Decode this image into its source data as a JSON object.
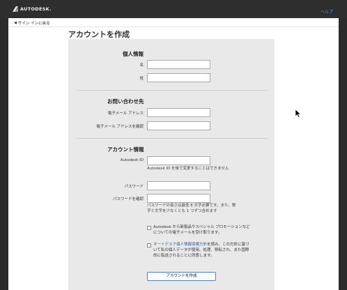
{
  "header": {
    "brand": "AUTODESK.",
    "help": "ヘルプ"
  },
  "nav": {
    "back": "サイン インに戻る"
  },
  "page": {
    "title": "アカウントを作成"
  },
  "personal": {
    "title": "個人情報",
    "first_name_label": "名",
    "last_name_label": "姓",
    "first_name_value": "",
    "last_name_value": ""
  },
  "contact": {
    "title": "お問い合わせ先",
    "email_label": "電子メール アドレス",
    "email_confirm_label": "電子メール アドレスを確認",
    "email_value": "",
    "email_confirm_value": ""
  },
  "account": {
    "title": "アカウント情報",
    "id_label": "Autodesk ID",
    "id_hint": "Autodesk ID を後で変更することはできません",
    "password_label": "パスワード",
    "password_confirm_label": "パスワードを確認",
    "password_hint": "パスワードの長さは最低 8 文字必要です。また、数字と文字を少なくとも 1 つずつ含めます",
    "id_value": "",
    "password_value": "",
    "password_confirm_value": ""
  },
  "consent": {
    "marketing_text": "Autodesk から新製品やスペシャル プロモーションなどについての電子メールを受け取ります。",
    "marketing_checked": false,
    "privacy_link": "オートデスク個人情報保護方針",
    "privacy_text": "を読み、この方針に基づいて私の個人データが使用、処理、移転され、また国際的に転送されることに同意します。",
    "privacy_checked": false
  },
  "actions": {
    "submit": "アカウントを作成"
  },
  "colors": {
    "topbar": "#2e2e2e",
    "panel": "#e9e9e9",
    "link": "#2a5db0",
    "help_link": "#5b8fd8"
  }
}
